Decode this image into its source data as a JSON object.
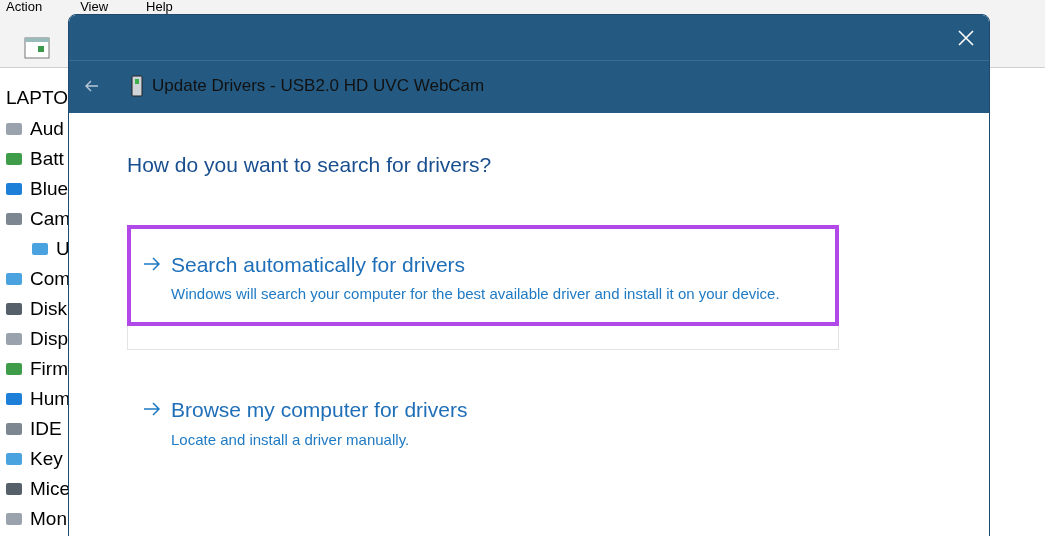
{
  "background_window": {
    "menu": [
      "Action",
      "View",
      "Help"
    ],
    "tree": {
      "root": "LAPTO",
      "items": [
        {
          "label": "Aud"
        },
        {
          "label": "Batt"
        },
        {
          "label": "Blue"
        },
        {
          "label": "Cam",
          "children": [
            {
              "label": "U"
            }
          ]
        },
        {
          "label": "Com"
        },
        {
          "label": "Disk"
        },
        {
          "label": "Disp"
        },
        {
          "label": "Firm"
        },
        {
          "label": "Hum"
        },
        {
          "label": "IDE"
        },
        {
          "label": "Key"
        },
        {
          "label": "Mice"
        },
        {
          "label": "Mon"
        }
      ]
    }
  },
  "dialog": {
    "title": "Update Drivers - USB2.0 HD UVC WebCam",
    "heading": "How do you want to search for drivers?",
    "options": [
      {
        "title": "Search automatically for drivers",
        "description": "Windows will search your computer for the best available driver and install it on your device.",
        "highlighted": true
      },
      {
        "title": "Browse my computer for drivers",
        "description": "Locate and install a driver manually.",
        "highlighted": false
      }
    ]
  }
}
